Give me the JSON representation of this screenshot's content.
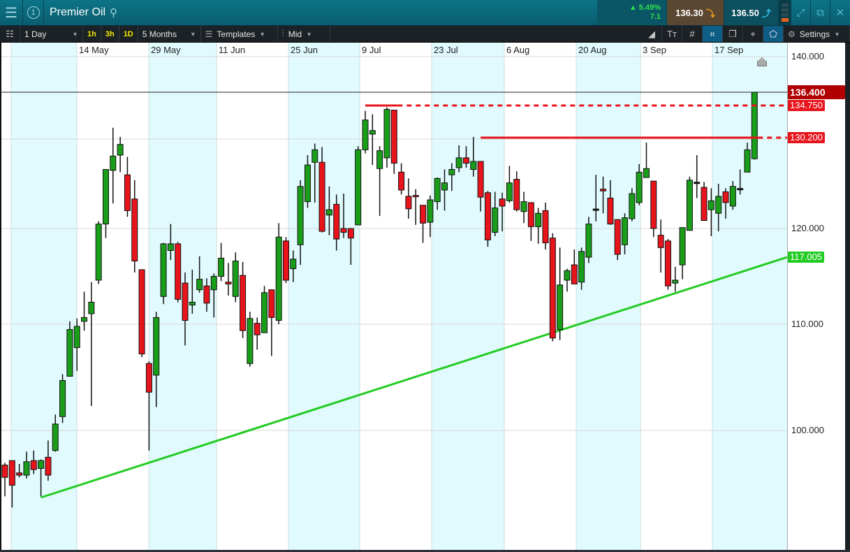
{
  "header": {
    "menu_icon": "hamburger-icon",
    "badge": "1",
    "title": "Premier Oil",
    "change_pct": "▲ 5.49%",
    "change_abs": "7.1",
    "sell_price": "136.30",
    "buy_price": "136.50"
  },
  "toolbar": {
    "interval": "1 Day",
    "quick_intervals": [
      "1h",
      "3h",
      "1D"
    ],
    "range": "5 Months",
    "templates": "Templates",
    "price_type": "Mid",
    "settings": "Settings"
  },
  "colors": {
    "up": "#1a9e1a",
    "down": "#e8141c",
    "band": "#e0fafd",
    "trend": "#22cc22",
    "resistance": "#e8141c",
    "last": "#b00000"
  },
  "chart_data": {
    "type": "candlestick",
    "title": "Premier Oil",
    "x_tick_labels": [
      "14 May",
      "29 May",
      "11 Jun",
      "25 Jun",
      "9 Jul",
      "23 Jul",
      "6 Aug",
      "20 Aug",
      "3 Sep",
      "17 Sep"
    ],
    "y_ticks": [
      100,
      110,
      120,
      130,
      140
    ],
    "y_tick_labels": [
      "100.000",
      "110.000",
      "120.000",
      "130.000",
      "140.000"
    ],
    "ylim": [
      93,
      140
    ],
    "scale": "log",
    "ohlc": [
      [
        96.9,
        97.1,
        94.1,
        95.8
      ],
      [
        97.3,
        97.3,
        93.1,
        95.1
      ],
      [
        96.2,
        97.0,
        95.8,
        96.0
      ],
      [
        96.0,
        98.1,
        95.7,
        97.2
      ],
      [
        97.3,
        98.2,
        96.1,
        96.5
      ],
      [
        96.6,
        97.4,
        94.1,
        97.3
      ],
      [
        97.6,
        99.1,
        95.5,
        96.0
      ],
      [
        98.2,
        101.5,
        98.1,
        100.6
      ],
      [
        101.3,
        105.3,
        100.7,
        104.7
      ],
      [
        105.1,
        110.3,
        105.1,
        109.5
      ],
      [
        107.8,
        110.6,
        105.6,
        109.8
      ],
      [
        110.3,
        113.4,
        109.4,
        110.7
      ],
      [
        111.1,
        114.4,
        102.3,
        112.3
      ],
      [
        114.6,
        120.8,
        114.2,
        120.5
      ],
      [
        120.5,
        126.6,
        119.0,
        126.6
      ],
      [
        126.5,
        131.6,
        122.8,
        128.1
      ],
      [
        128.2,
        130.3,
        126.3,
        129.4
      ],
      [
        126.0,
        128.0,
        121.3,
        122.0
      ],
      [
        123.3,
        125.4,
        115.4,
        116.6
      ],
      [
        115.7,
        115.7,
        106.9,
        107.2
      ],
      [
        106.3,
        106.5,
        98.2,
        103.6
      ],
      [
        105.2,
        111.3,
        102.2,
        110.7
      ],
      [
        112.9,
        118.5,
        112.1,
        118.4
      ],
      [
        117.7,
        120.5,
        116.7,
        118.4
      ],
      [
        118.4,
        118.6,
        112.3,
        112.6
      ],
      [
        114.3,
        115.4,
        108.0,
        110.4
      ],
      [
        112.0,
        115.7,
        111.1,
        112.3
      ],
      [
        113.6,
        117.1,
        113.3,
        114.7
      ],
      [
        114.0,
        114.8,
        111.3,
        112.2
      ],
      [
        113.6,
        115.3,
        110.7,
        115.0
      ],
      [
        115.0,
        118.5,
        114.5,
        116.9
      ],
      [
        114.4,
        116.4,
        113.0,
        114.2
      ],
      [
        112.9,
        117.5,
        112.3,
        116.6
      ],
      [
        115.1,
        116.5,
        108.7,
        109.4
      ],
      [
        106.3,
        111.3,
        106.0,
        110.6
      ],
      [
        110.1,
        110.7,
        107.6,
        109.0
      ],
      [
        109.2,
        114.0,
        109.2,
        113.3
      ],
      [
        113.6,
        113.6,
        107.0,
        110.7
      ],
      [
        110.4,
        120.6,
        110.0,
        119.1
      ],
      [
        118.7,
        119.1,
        114.3,
        114.6
      ],
      [
        115.8,
        117.7,
        114.4,
        116.8
      ],
      [
        118.3,
        125.4,
        116.2,
        124.7
      ],
      [
        123.0,
        128.2,
        122.3,
        127.1
      ],
      [
        127.4,
        129.5,
        122.9,
        128.8
      ],
      [
        127.4,
        129.1,
        119.6,
        119.7
      ],
      [
        121.5,
        124.7,
        119.3,
        122.1
      ],
      [
        122.7,
        123.8,
        117.7,
        118.9
      ],
      [
        120.0,
        123.9,
        119.0,
        119.6
      ],
      [
        120.0,
        120.0,
        116.2,
        119.0
      ],
      [
        120.4,
        129.2,
        120.4,
        128.8
      ],
      [
        128.8,
        134.0,
        128.4,
        132.7
      ],
      [
        130.7,
        133.5,
        127.1,
        131.2
      ],
      [
        126.7,
        129.2,
        121.4,
        128.7
      ],
      [
        127.9,
        134.5,
        126.8,
        134.2
      ],
      [
        134.1,
        134.1,
        126.1,
        127.3
      ],
      [
        126.3,
        127.3,
        123.8,
        124.3
      ],
      [
        123.6,
        125.6,
        121.1,
        122.2
      ],
      [
        123.7,
        124.4,
        120.4,
        123.6
      ],
      [
        122.6,
        122.6,
        118.5,
        120.6
      ],
      [
        120.7,
        123.7,
        119.1,
        123.2
      ],
      [
        123.0,
        125.7,
        122.1,
        125.6
      ],
      [
        124.3,
        126.6,
        122.0,
        125.1
      ],
      [
        126.0,
        127.3,
        124.2,
        126.6
      ],
      [
        126.8,
        129.3,
        126.3,
        127.9
      ],
      [
        127.9,
        129.2,
        126.8,
        127.3
      ],
      [
        126.6,
        130.3,
        125.8,
        127.5
      ],
      [
        127.5,
        127.5,
        121.9,
        123.5
      ],
      [
        124.0,
        124.2,
        118.1,
        118.8
      ],
      [
        119.6,
        124.1,
        119.2,
        122.3
      ],
      [
        123.3,
        124.0,
        119.7,
        122.5
      ],
      [
        123.1,
        127.0,
        122.9,
        125.1
      ],
      [
        125.5,
        126.4,
        121.9,
        122.1
      ],
      [
        121.9,
        124.1,
        120.6,
        123.0
      ],
      [
        122.9,
        122.9,
        118.7,
        120.2
      ],
      [
        120.2,
        122.3,
        118.4,
        121.7
      ],
      [
        122.0,
        122.9,
        117.8,
        118.5
      ],
      [
        119.0,
        119.5,
        108.4,
        108.7
      ],
      [
        109.5,
        118.0,
        108.5,
        114.1
      ],
      [
        114.6,
        115.8,
        113.4,
        115.6
      ],
      [
        116.2,
        117.8,
        114.2,
        114.2
      ],
      [
        114.4,
        118.0,
        113.6,
        117.6
      ],
      [
        117.0,
        121.3,
        116.4,
        120.5
      ],
      [
        122.1,
        126.0,
        120.8,
        122.1
      ],
      [
        124.4,
        125.8,
        121.7,
        124.2
      ],
      [
        123.4,
        125.4,
        120.4,
        120.5
      ],
      [
        121.0,
        121.0,
        116.7,
        117.3
      ],
      [
        118.3,
        121.7,
        117.3,
        121.2
      ],
      [
        121.1,
        124.5,
        120.8,
        123.9
      ],
      [
        122.9,
        127.2,
        122.6,
        126.3
      ],
      [
        125.7,
        129.6,
        125.7,
        126.7
      ],
      [
        125.3,
        125.3,
        119.1,
        120.0
      ],
      [
        119.3,
        121.0,
        115.4,
        118.0
      ],
      [
        118.7,
        118.9,
        113.6,
        114.0
      ],
      [
        114.3,
        116.0,
        113.4,
        114.6
      ],
      [
        116.2,
        120.1,
        114.7,
        120.1
      ],
      [
        119.8,
        125.8,
        119.8,
        125.4
      ],
      [
        125.1,
        128.2,
        123.4,
        125.1
      ],
      [
        124.6,
        125.2,
        120.9,
        120.9
      ],
      [
        122.1,
        124.5,
        119.2,
        123.1
      ],
      [
        121.7,
        125.0,
        119.7,
        123.6
      ],
      [
        124.1,
        124.5,
        121.1,
        122.9
      ],
      [
        122.5,
        125.3,
        122.1,
        124.7
      ],
      [
        124.4,
        126.6,
        123.8,
        124.4
      ],
      [
        126.3,
        129.6,
        126.3,
        128.8
      ],
      [
        127.8,
        136.4,
        127.7,
        136.4
      ]
    ],
    "last_price": {
      "value": 136.4,
      "label": "136.400"
    },
    "resistance_lines": [
      {
        "value": 134.75,
        "label": "134.750",
        "from_candle": 51
      },
      {
        "value": 130.2,
        "label": "130.200",
        "from_candle": 67
      }
    ],
    "trendline": {
      "from_candle": 6,
      "from_value": 94.0,
      "to_value": 117.005,
      "label": "117.005"
    }
  }
}
